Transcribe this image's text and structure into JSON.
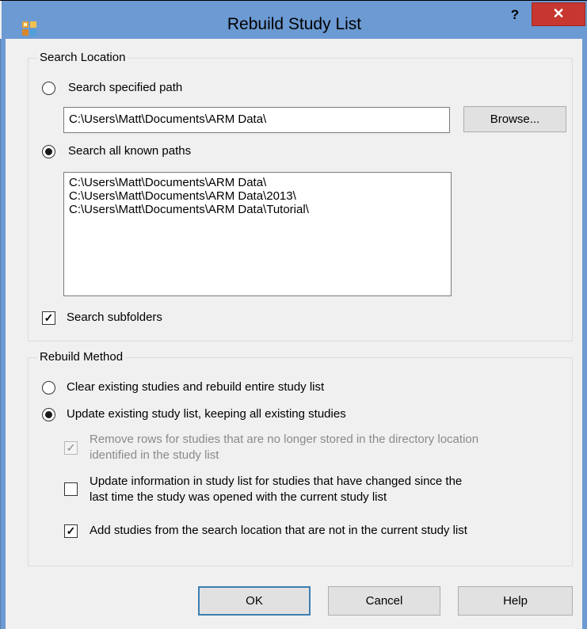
{
  "window": {
    "title": "Rebuild Study List",
    "help_label": "?",
    "close_label": "✕",
    "icon": "app-icon"
  },
  "search_location": {
    "legend": "Search Location",
    "specified_label": "Search specified path",
    "specified_checked": false,
    "path_value": "C:\\Users\\Matt\\Documents\\ARM Data\\",
    "browse_label": "Browse...",
    "known_label": "Search all known paths",
    "known_checked": true,
    "known_paths": [
      "C:\\Users\\Matt\\Documents\\ARM Data\\",
      "C:\\Users\\Matt\\Documents\\ARM Data\\2013\\",
      "C:\\Users\\Matt\\Documents\\ARM Data\\Tutorial\\"
    ],
    "subfolders_label": "Search subfolders",
    "subfolders_checked": true
  },
  "rebuild_method": {
    "legend": "Rebuild Method",
    "clear_label": "Clear existing studies and rebuild entire study list",
    "clear_checked": false,
    "update_label": "Update existing study list, keeping all existing studies",
    "update_checked": true,
    "remove_rows_line1": "Remove rows for studies that are no longer stored in the directory location",
    "remove_rows_line2": "identified in the study list",
    "remove_rows_checked": true,
    "update_info_line1": "Update information in study list for studies that have changed since the",
    "update_info_line2": "last time the study was opened with the current study list",
    "update_info_checked": false,
    "add_studies_label": "Add studies from the search location that are not in the current study list",
    "add_studies_checked": true
  },
  "buttons": {
    "ok": "OK",
    "cancel": "Cancel",
    "help": "Help"
  }
}
